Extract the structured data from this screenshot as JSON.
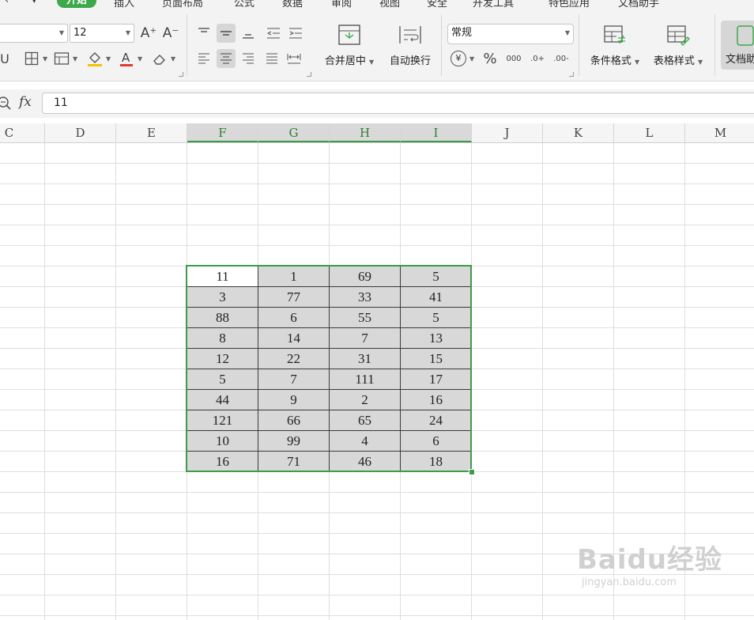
{
  "menu": {
    "items": [
      "‹",
      "▾",
      "开始",
      "插入",
      "页面布局",
      "公式",
      "数据",
      "审阅",
      "视图",
      "安全",
      "开发工具",
      "特色应用",
      "文档助手"
    ],
    "active": "开始"
  },
  "ribbon": {
    "font_size": "12",
    "number_format": "常规",
    "merge_center_label": "合并居中",
    "wrap_text_label": "自动换行",
    "conditional_format_label": "条件格式",
    "table_style_label": "表格样式",
    "doc_label": "文档助",
    "increase_font_icon": "A⁺",
    "decrease_font_icon": "A⁻",
    "currency_icon": "¥",
    "percent_icon": "%",
    "thousands_icon": "000",
    "inc_decimal_icon": ".0+",
    "dec_decimal_icon": ".00-",
    "accent_color": "#3ea94a",
    "font_color": "#e53935",
    "fill_color": "#f2c500"
  },
  "formula_bar": {
    "fx_label": "fx",
    "value": "11"
  },
  "columns": [
    "C",
    "D",
    "E",
    "F",
    "G",
    "H",
    "I",
    "J",
    "K",
    "L",
    "M"
  ],
  "selected_columns": [
    "F",
    "G",
    "H",
    "I"
  ],
  "table": {
    "rows": [
      [
        "11",
        "1",
        "69",
        "5"
      ],
      [
        "3",
        "77",
        "33",
        "41"
      ],
      [
        "88",
        "6",
        "55",
        "5"
      ],
      [
        "8",
        "14",
        "7",
        "13"
      ],
      [
        "12",
        "22",
        "31",
        "15"
      ],
      [
        "5",
        "7",
        "111",
        "17"
      ],
      [
        "44",
        "9",
        "2",
        "16"
      ],
      [
        "121",
        "66",
        "65",
        "24"
      ],
      [
        "10",
        "99",
        "4",
        "6"
      ],
      [
        "16",
        "71",
        "46",
        "18"
      ]
    ]
  },
  "watermark": {
    "main": "Baidu经验",
    "sub": "jingyan.baidu.com"
  }
}
